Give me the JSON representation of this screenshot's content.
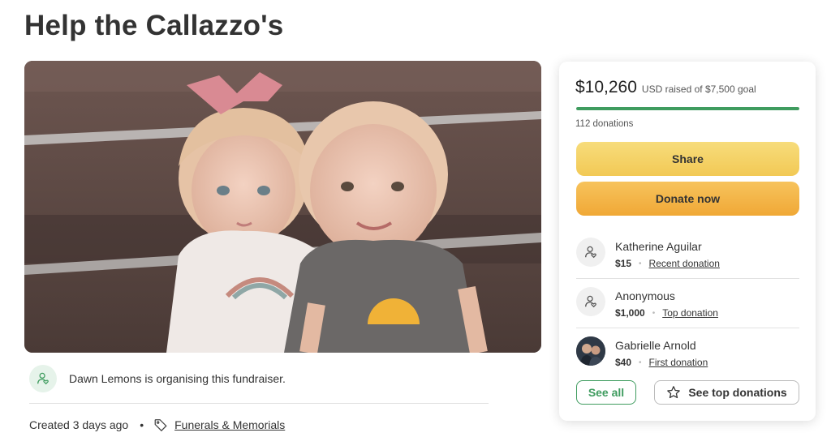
{
  "page": {
    "title": "Help the Callazzo's"
  },
  "organiser": {
    "text": "Dawn Lemons is organising this fundraiser.",
    "icon": "person-heart-icon"
  },
  "meta": {
    "created": "Created 3 days ago",
    "separator": "•",
    "category": "Funerals & Memorials",
    "category_icon": "tag-icon"
  },
  "donation_card": {
    "amount": "$10,260",
    "goal_text": "USD raised of $7,500 goal",
    "progress_fraction": 1.0,
    "progress_color": "#3f9c5f",
    "donation_count": "112 donations",
    "share_label": "Share",
    "donate_label": "Donate now",
    "donors": [
      {
        "name": "Katherine Aguilar",
        "amount": "$15",
        "type": "Recent donation",
        "avatar": "person-heart-icon"
      },
      {
        "name": "Anonymous",
        "amount": "$1,000",
        "type": "Top donation",
        "avatar": "person-heart-icon"
      },
      {
        "name": "Gabrielle Arnold",
        "amount": "$40",
        "type": "First donation",
        "avatar": "photo-avatar"
      }
    ],
    "see_all_label": "See all",
    "see_top_label": "See top donations",
    "see_top_icon": "star-icon"
  },
  "colors": {
    "accent_green": "#3f9c5f",
    "share_yellow": "#f2c955",
    "donate_orange": "#f0a836"
  }
}
